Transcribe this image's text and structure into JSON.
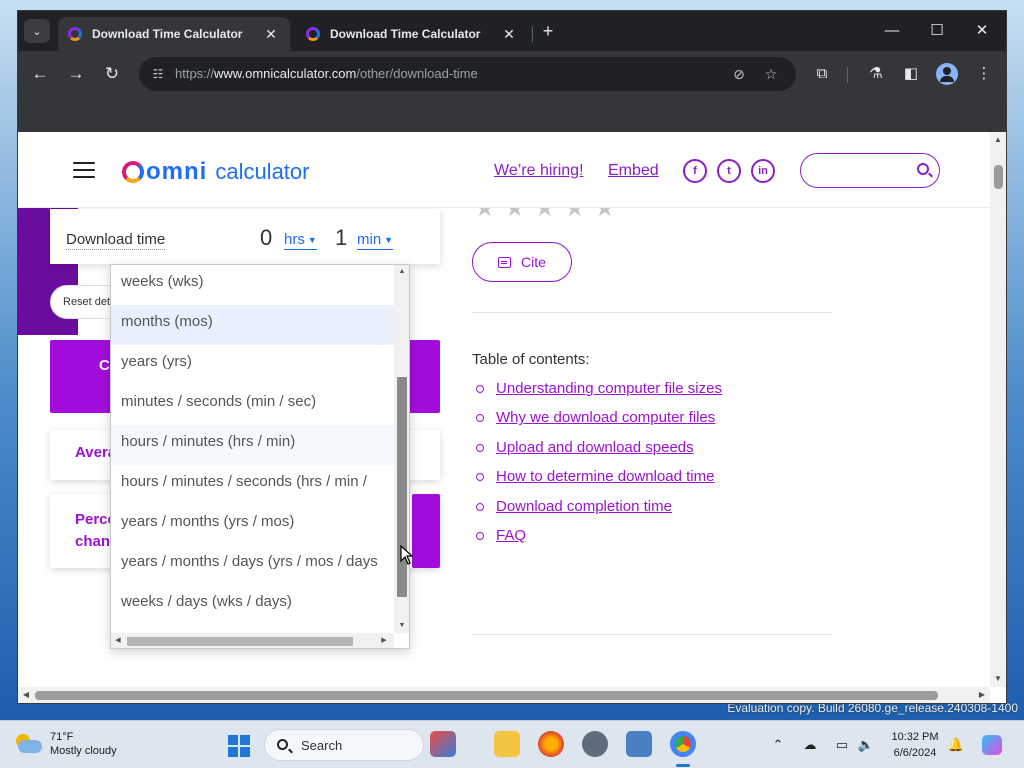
{
  "browser": {
    "tabs": [
      {
        "title": "Download Time Calculator",
        "active": true
      },
      {
        "title": "Download Time Calculator",
        "active": false
      }
    ],
    "url_prefix": "https://",
    "url_host": "www.omnicalculator.com",
    "url_path": "/other/download-time"
  },
  "site": {
    "logo_brand": "omni",
    "logo_word": "calculator",
    "hiring_link": "We’re hiring!",
    "embed_link": "Embed",
    "social": [
      "f",
      "t",
      "in"
    ]
  },
  "calculator": {
    "field_label": "Download time",
    "hours_value": "0",
    "hours_unit": "hrs",
    "minutes_value": "1",
    "minutes_unit": "min",
    "reset_label": "Reset det",
    "card_avg_text": "Avera",
    "card_pct_line1": "Perce",
    "card_pct_line2": "chan",
    "block_letter": "C"
  },
  "dropdown": {
    "items": [
      {
        "label": "weeks (wks)",
        "state": "normal"
      },
      {
        "label": "months (mos)",
        "state": "selected"
      },
      {
        "label": "years (yrs)",
        "state": "normal"
      },
      {
        "label": "minutes / seconds (min / sec)",
        "state": "normal"
      },
      {
        "label": "hours / minutes (hrs / min)",
        "state": "hovered"
      },
      {
        "label": "hours / minutes / seconds (hrs / min / ",
        "state": "normal"
      },
      {
        "label": "years / months (yrs / mos)",
        "state": "normal"
      },
      {
        "label": "years / months / days (yrs / mos / days",
        "state": "normal"
      },
      {
        "label": "weeks / days (wks / days)",
        "state": "normal"
      }
    ]
  },
  "article": {
    "cite_label": "Cite",
    "toc_title": "Table of contents:",
    "toc": [
      "Understanding computer file sizes",
      "Why we download computer files",
      "Upload and download speeds",
      "How to determine download time",
      "Download completion time",
      "FAQ"
    ]
  },
  "taskbar": {
    "temperature": "71°F",
    "weather_desc": "Mostly cloudy",
    "search_label": "Search",
    "time": "10:32 PM",
    "date": "6/6/2024"
  },
  "desktop": {
    "watermark": "Evaluation copy. Build 26080.ge_release.240308-1400"
  },
  "colors": {
    "accent_purple": "#9b12d4",
    "omni_blue": "#1e6ff5",
    "link_blue": "#1d6fe0"
  }
}
